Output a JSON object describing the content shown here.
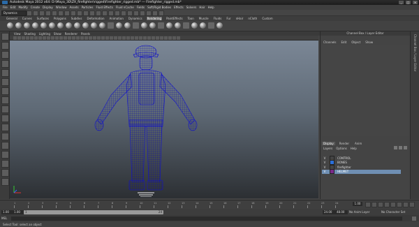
{
  "window": {
    "title": "Autodesk Maya 2012 x64: D:\\Maya_3D\\ZX_firefighter\\rigged\\Firefighter_rigged.mb* --- Firefighter_rigged.mb*",
    "controls": [
      "_",
      "□",
      "×"
    ]
  },
  "menubar": [
    "File",
    "Edit",
    "Modify",
    "Create",
    "Display",
    "Window",
    "Assets",
    "Particles",
    "Fluid Effects",
    "Fluid nCache",
    "Fields",
    "Soft/Rigid Bodies",
    "Effects",
    "Solvers",
    "Hair",
    "Help"
  ],
  "status": {
    "mode": "Dynamics"
  },
  "shelf_tabs": {
    "items": [
      "General",
      "Curves",
      "Surfaces",
      "Polygons",
      "Subdivs",
      "Deformation",
      "Animation",
      "Dynamics",
      "Rendering",
      "PaintEffects",
      "Toon",
      "Muscle",
      "Fluids",
      "Fur",
      "nHair",
      "nCloth",
      "Custom"
    ],
    "active": "Rendering"
  },
  "viewport": {
    "menu": [
      "View",
      "Shading",
      "Lighting",
      "Show",
      "Renderer",
      "Panels"
    ],
    "wire_color": "#1a1aff",
    "bg_top": "#7b8796",
    "bg_bottom": "#2c2f33"
  },
  "channel_box": {
    "title": "Channel Box / Layer Editor",
    "menu": [
      "Channels",
      "Edit",
      "Object",
      "Show"
    ]
  },
  "layer_editor": {
    "tabs": [
      "Display",
      "Render",
      "Anim"
    ],
    "active_tab": "Display",
    "menu": [
      "Layers",
      "Options",
      "Help"
    ],
    "layers": [
      {
        "vis": "V",
        "name": "CONTROL",
        "color": "#444444",
        "selected": false
      },
      {
        "vis": "V",
        "name": "BONES",
        "color": "#2b6fd8",
        "selected": false
      },
      {
        "vis": "V",
        "name": "firefighter",
        "color": "#444444",
        "selected": false
      },
      {
        "vis": "V",
        "name": "HELMET",
        "color": "#7a2a8a",
        "selected": true
      }
    ]
  },
  "sidebar_label": "Channel Box / Layer Editor",
  "timeline": {
    "ticks": [
      "1",
      "2",
      "3",
      "4",
      "5",
      "6",
      "7",
      "8",
      "9",
      "10",
      "11",
      "12",
      "13",
      "14",
      "15",
      "16",
      "17",
      "18",
      "19",
      "20",
      "21",
      "22",
      "23",
      "24"
    ],
    "current_frame": "1.00"
  },
  "range": {
    "start": "1.00",
    "inner_start": "1.00",
    "slider_start": "1",
    "slider_end": "24",
    "inner_end": "24.00",
    "end": "48.00",
    "anim_layer": "No Anim Layer",
    "char_set": "No Character Set"
  },
  "command": {
    "label": "MEL"
  },
  "help_line": "Select Tool: select an object"
}
